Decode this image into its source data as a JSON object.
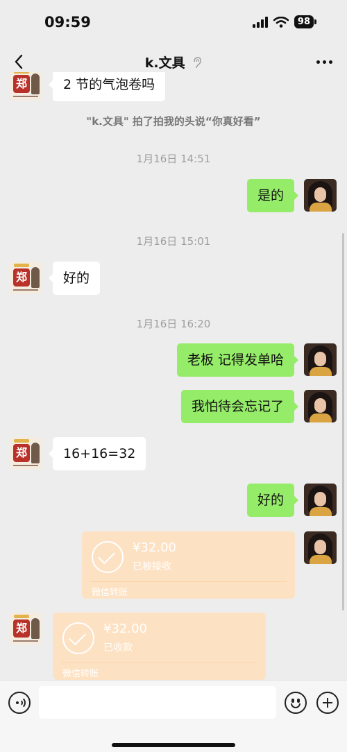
{
  "status_bar": {
    "time": "09:59",
    "battery": "98"
  },
  "header": {
    "title": "k.文具",
    "back_icon": "chevron-left-icon",
    "more_icon": "more-dots-icon",
    "ear_icon": "ear-icon"
  },
  "messages": {
    "m1": "2 节的气泡卷吗",
    "system1": "\"k.文具\" 拍了拍我的头说“你真好看”",
    "ts1": "1月16日 14:51",
    "m2": "是的",
    "ts2": "1月16日 15:01",
    "m3": "好的",
    "ts3": "1月16日 16:20",
    "m4": "老板 记得发单哈",
    "m5": "我怕待会忘记了",
    "m6": "16+16=32",
    "m7": "好的"
  },
  "transfers": {
    "t1": {
      "amount": "¥32.00",
      "status": "已被接收",
      "footer": "微信转账"
    },
    "t2": {
      "amount": "¥32.00",
      "status": "已收款",
      "footer": "微信转账"
    }
  },
  "input_bar": {
    "placeholder": "",
    "voice_icon": "voice-icon",
    "emoji_icon": "emoji-icon",
    "plus_icon": "plus-icon"
  },
  "colors": {
    "background": "#ededed",
    "outgoing_bubble": "#95ec69",
    "incoming_bubble": "#ffffff",
    "transfer_card": "#fde1c3"
  }
}
